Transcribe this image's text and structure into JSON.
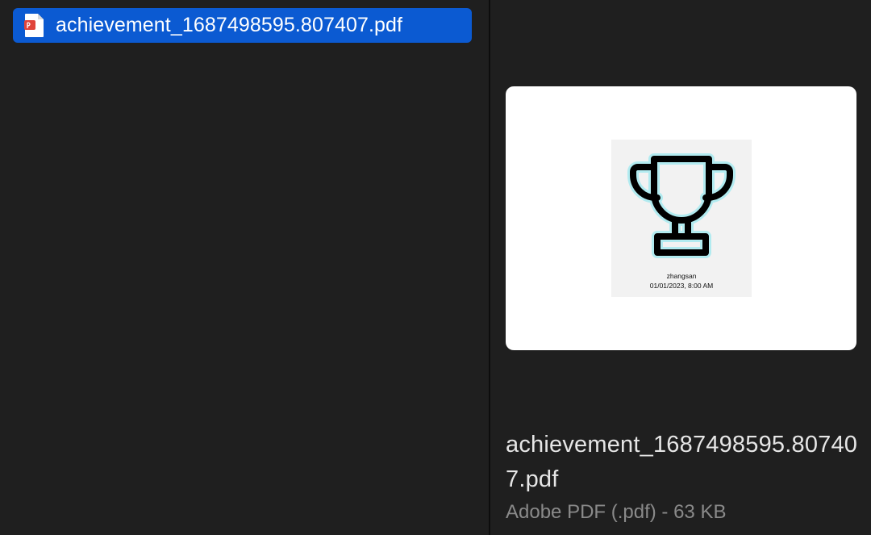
{
  "file_list": {
    "selected_item": {
      "name": "achievement_1687498595.807407.pdf",
      "icon": "pdf-document-icon"
    }
  },
  "preview": {
    "thumbnail": {
      "icon": "trophy-icon",
      "user": "zhangsan",
      "datetime": "01/01/2023, 8:00 AM"
    },
    "file_name": "achievement_1687498595.807407.pdf",
    "file_info": "Adobe PDF (.pdf) - 63 KB"
  },
  "colors": {
    "selection": "#0b5ad2",
    "background": "#1f1f1f",
    "pdf_icon_red": "#e0443a",
    "trophy_glow": "#7fe7f0"
  }
}
